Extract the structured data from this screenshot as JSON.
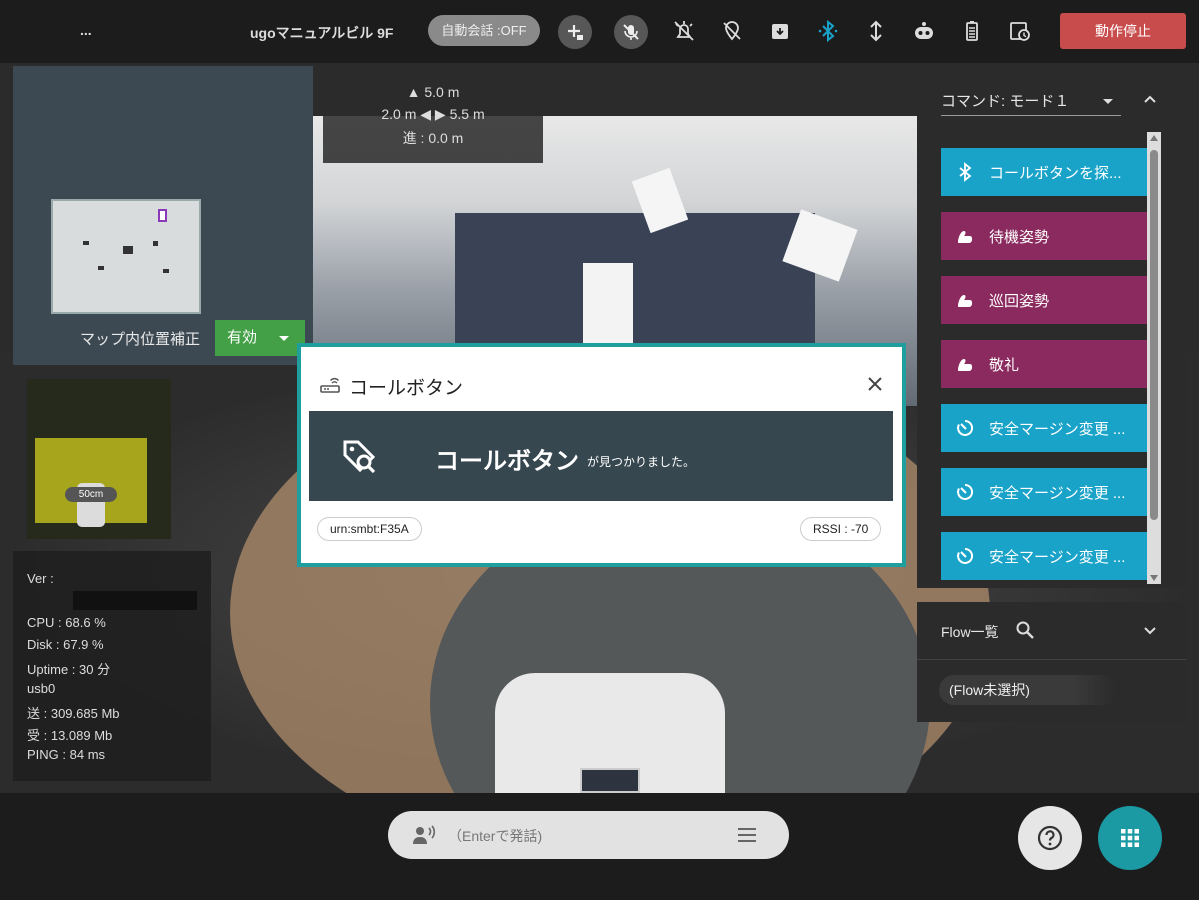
{
  "topbar": {
    "menu": "...",
    "robot_name": "ugoマニュアルビル 9F",
    "auto_talk": "自動会話 :OFF",
    "stop_button": "動作停止",
    "icons": [
      "add-lock-icon",
      "mic-off-icon",
      "alarm-off-icon",
      "location-off-icon",
      "archive-down-icon",
      "bluetooth-icon",
      "height-icon",
      "robot-icon",
      "battery-icon",
      "history-icon"
    ],
    "bluetooth_color": "#1aa3c9",
    "stop_color": "#c94c4c"
  },
  "distance": {
    "front": "▲ 5.0 m",
    "sides": "2.0 m ◀ ▶ 5.5 m",
    "advance": "進 : 0.0 m"
  },
  "map": {
    "label": "マップ内位置補正",
    "select_value": "有効",
    "select_color": "#43a047"
  },
  "sensor": {
    "scale": "50cm"
  },
  "stats": {
    "ver": "Ver :",
    "cpu": "CPU : 68.6 %",
    "disk": "Disk : 67.9 %",
    "uptime": "Uptime : 30 分",
    "iface": "usb0",
    "sent": "送 : 309.685 Mb",
    "recv": "受 : 13.089 Mb",
    "ping": "PING : 84 ms"
  },
  "command": {
    "header": "コマンド: モード１",
    "buttons": [
      {
        "label": "コールボタンを探...",
        "icon": "bluetooth-icon",
        "color": "#1aa3c9"
      },
      {
        "label": "待機姿勢",
        "icon": "arm-icon",
        "color": "#8b2a5e"
      },
      {
        "label": "巡回姿勢",
        "icon": "arm-icon",
        "color": "#8b2a5e"
      },
      {
        "label": "敬礼",
        "icon": "arm-icon",
        "color": "#8b2a5e"
      },
      {
        "label": "安全マージン変更 ...",
        "icon": "timer-icon",
        "color": "#1aa3c9"
      },
      {
        "label": "安全マージン変更 ...",
        "icon": "timer-icon",
        "color": "#1aa3c9"
      },
      {
        "label": "安全マージン変更 ...",
        "icon": "timer-icon",
        "color": "#1aa3c9"
      }
    ]
  },
  "flow": {
    "title": "Flow一覧",
    "selected": "(Flow未選択)"
  },
  "speech": {
    "placeholder": "（Enterで発話)"
  },
  "modal": {
    "title": "コールボタン",
    "banner_main": "コールボタン",
    "banner_sub": "が見つかりました。",
    "device_id": "urn:smbt:F35A",
    "rssi": "RSSI : -70",
    "border_color": "#1f9e9e"
  }
}
